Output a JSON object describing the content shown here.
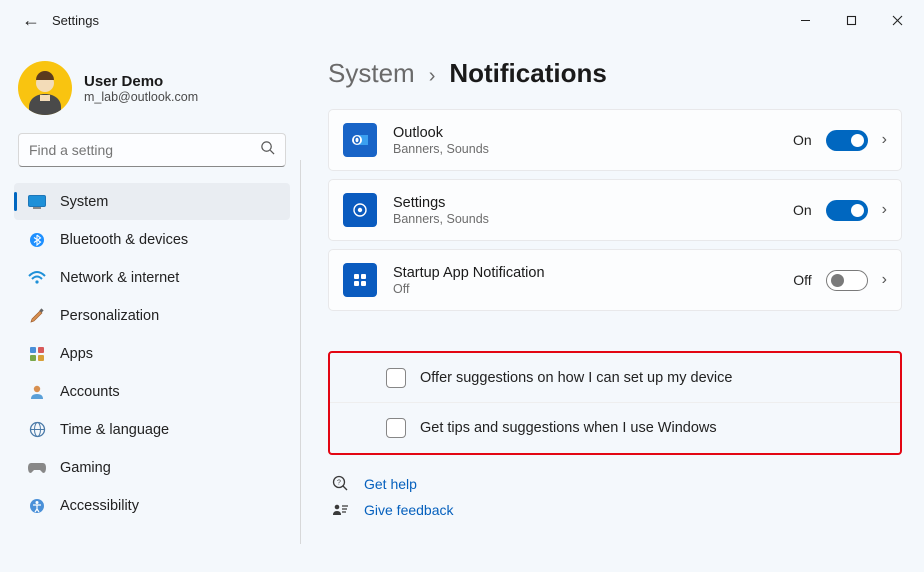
{
  "window": {
    "title": "Settings"
  },
  "user": {
    "name": "User Demo",
    "email": "m_lab@outlook.com"
  },
  "search": {
    "placeholder": "Find a setting"
  },
  "nav": [
    {
      "label": "System",
      "selected": true
    },
    {
      "label": "Bluetooth & devices"
    },
    {
      "label": "Network & internet"
    },
    {
      "label": "Personalization"
    },
    {
      "label": "Apps"
    },
    {
      "label": "Accounts"
    },
    {
      "label": "Time & language"
    },
    {
      "label": "Gaming"
    },
    {
      "label": "Accessibility"
    }
  ],
  "breadcrumb": {
    "parent": "System",
    "current": "Notifications"
  },
  "senders": [
    {
      "title": "Outlook",
      "sub": "Banners, Sounds",
      "state": "On",
      "on": true
    },
    {
      "title": "Settings",
      "sub": "Banners, Sounds",
      "state": "On",
      "on": true
    },
    {
      "title": "Startup App Notification",
      "sub": "Off",
      "state": "Off",
      "on": false
    }
  ],
  "checkboxes": [
    {
      "label": "Offer suggestions on how I can set up my device",
      "checked": false
    },
    {
      "label": "Get tips and suggestions when I use Windows",
      "checked": false
    }
  ],
  "footer": {
    "help": "Get help",
    "feedback": "Give feedback"
  },
  "highlight_color": "#e30613",
  "accent_color": "#0067c0"
}
